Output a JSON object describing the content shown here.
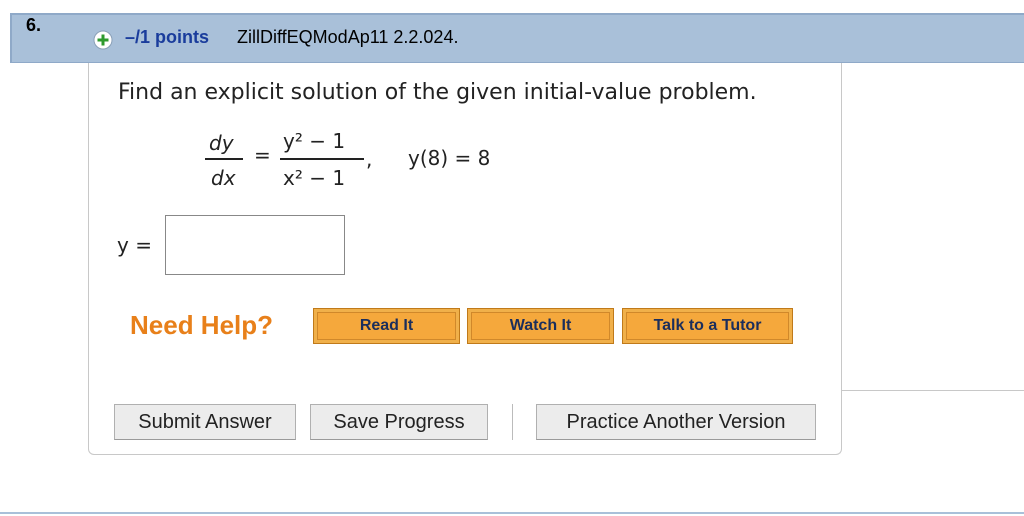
{
  "question": {
    "number": "6.",
    "points": "–/1 points",
    "code": "ZillDiffEQModAp11 2.2.024."
  },
  "problem": {
    "prompt": "Find an explicit solution of the given initial-value problem.",
    "lhs_num": "dy",
    "lhs_den": "dx",
    "equals": "=",
    "rhs_num": "y² − 1",
    "rhs_den": "x² − 1",
    "comma": ",",
    "initial_condition": "y(8) = 8"
  },
  "answer": {
    "label": "y =",
    "value": ""
  },
  "help": {
    "title": "Need Help?",
    "read_it": "Read It",
    "watch_it": "Watch It",
    "talk_tutor": "Talk to a Tutor"
  },
  "actions": {
    "submit": "Submit Answer",
    "save": "Save Progress",
    "practice": "Practice Another Version"
  },
  "colors": {
    "header_bg": "#a9c0d9",
    "points_text": "#1a3c9c",
    "need_help": "#e8801a",
    "help_button": "#f5a83c"
  }
}
